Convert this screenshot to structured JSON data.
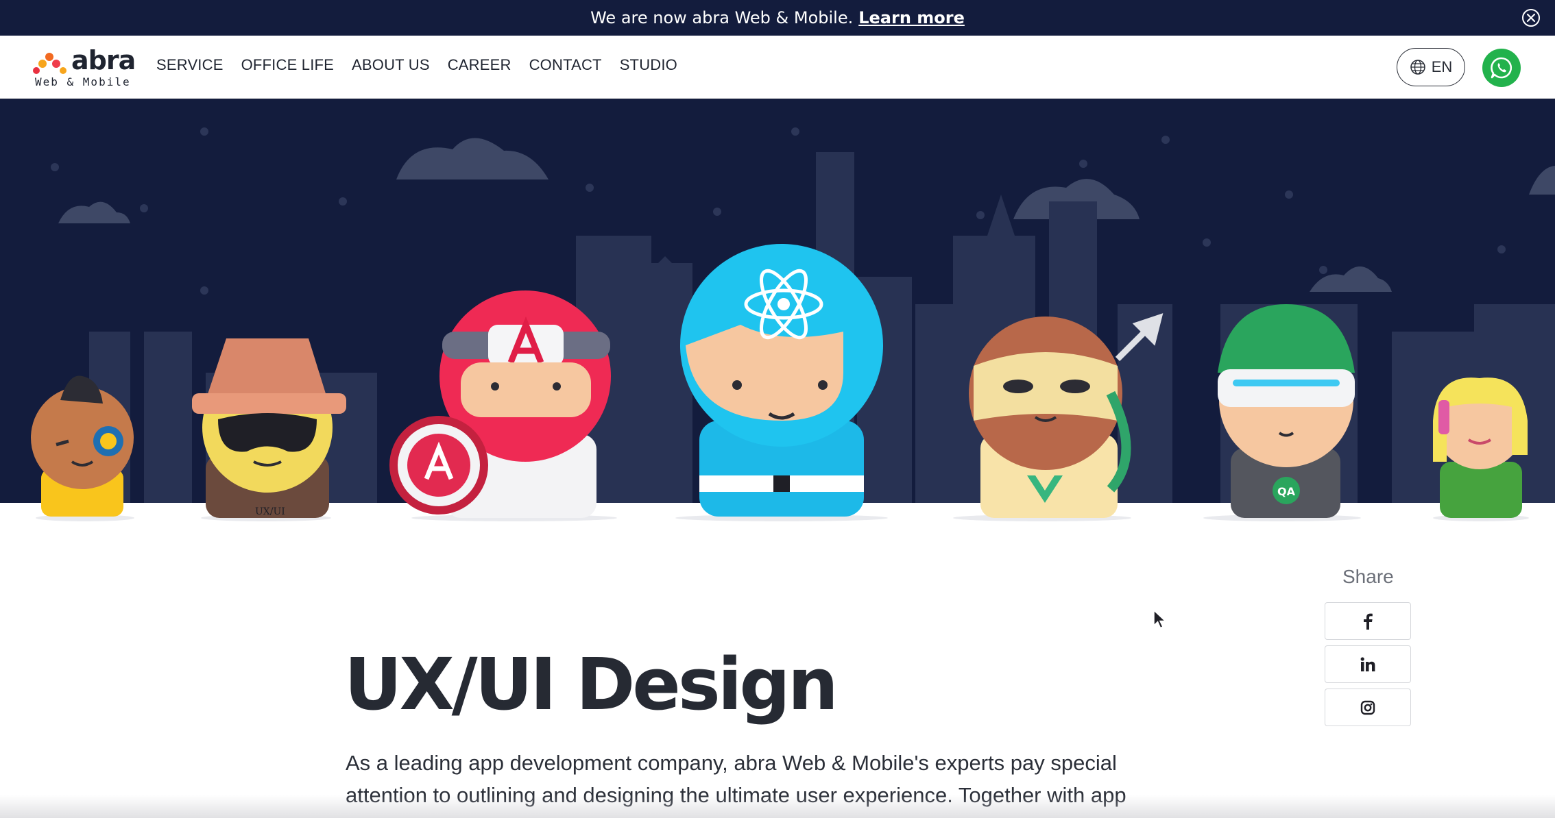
{
  "announcement": {
    "text": "We are now abra Web & Mobile.",
    "link_label": "Learn more"
  },
  "header": {
    "logo_word": "abra",
    "logo_tagline": "Web & Mobile",
    "nav": [
      "SERVICE",
      "OFFICE LIFE",
      "ABOUT US",
      "CAREER",
      "CONTACT",
      "STUDIO"
    ],
    "language": "EN"
  },
  "share": {
    "label": "Share",
    "buttons": [
      "facebook-icon",
      "linkedin-icon",
      "instagram-icon"
    ]
  },
  "page": {
    "title": "UX/UI Design",
    "intro": "As a leading app development company, abra Web & Mobile's experts pay special attention to outlining and designing the ultimate user experience. Together with app"
  },
  "hero": {
    "character_labels": [
      "UX/UI",
      "QA"
    ]
  },
  "colors": {
    "night_sky": "#131c3d",
    "whatsapp": "#22b24c",
    "text": "#262a33"
  }
}
